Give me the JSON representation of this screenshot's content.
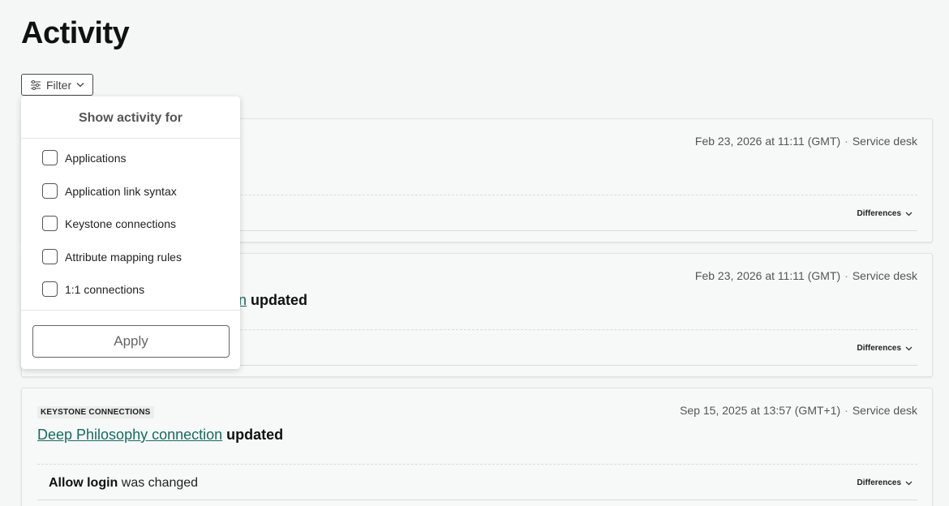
{
  "page": {
    "title": "Activity"
  },
  "filter": {
    "label": "Filter"
  },
  "dropdown": {
    "title": "Show activity for",
    "options": [
      {
        "label": "Applications",
        "checked": false
      },
      {
        "label": "Application link syntax",
        "checked": false
      },
      {
        "label": "Keystone connections",
        "checked": false
      },
      {
        "label": "Attribute mapping rules",
        "checked": false
      },
      {
        "label": "1:1 connections",
        "checked": false
      }
    ],
    "apply_label": "Apply"
  },
  "cards": [
    {
      "meta_time": "Feb 23, 2026 at 11:11 (GMT)",
      "meta_source": "Service desk",
      "differences_label": "Differences"
    },
    {
      "meta_time": "Feb 23, 2026 at 11:11 (GMT)",
      "meta_source": "Service desk",
      "heading_link_visible": "ion",
      "heading_action": "updated",
      "differences_label": "Differences"
    },
    {
      "tag": "KEYSTONE CONNECTIONS",
      "meta_time": "Sep 15, 2025 at 13:57 (GMT+1)",
      "meta_source": "Service desk",
      "heading_link": "Deep Philosophy connection",
      "heading_action": "updated",
      "change_field": "Allow login",
      "change_text": "was changed",
      "differences_label": "Differences"
    }
  ],
  "colors": {
    "link": "#146b62",
    "background": "#f5f7f7"
  },
  "icons": {
    "filter": "sliders-icon",
    "chevron": "chevron-down-icon"
  }
}
